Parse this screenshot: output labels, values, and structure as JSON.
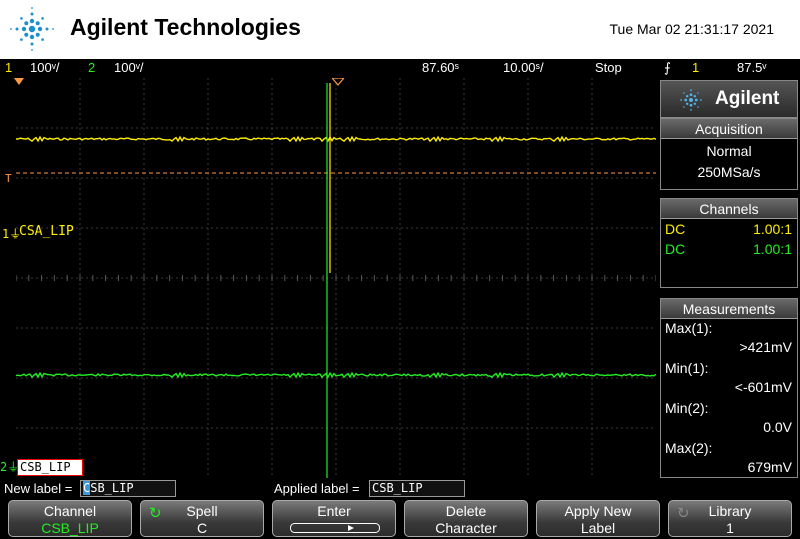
{
  "header": {
    "brand": "Agilent Technologies",
    "datetime": "Tue Mar 02 21:31:17 2021"
  },
  "statusbar": {
    "ch1_num": "1",
    "ch1_scale": "100ᵛ/",
    "ch2_num": "2",
    "ch2_scale": "100ᵛ/",
    "delay": "87.60ˢ",
    "timebase": "10.00ˢ/",
    "run_state": "Stop",
    "trig_icon": "⨍",
    "trig_source": "1",
    "trig_level": "87.5ᵛ"
  },
  "screen": {
    "ch1_tag": "1⏚",
    "ch1_label": "CSA_LIP",
    "trig_marker": "T",
    "ch2_tag": "2⏚",
    "ch2_label": "CSB_LIP"
  },
  "panel": {
    "agilent": "Agilent",
    "acquisition": {
      "title": "Acquisition",
      "mode": "Normal",
      "rate": "250MSa/s"
    },
    "channels": {
      "title": "Channels",
      "rows": [
        {
          "coupling": "DC",
          "probe": "1.00:1",
          "color": "#ffee00"
        },
        {
          "coupling": "DC",
          "probe": "1.00:1",
          "color": "#22ee22"
        }
      ]
    },
    "measurements": {
      "title": "Measurements",
      "items": [
        {
          "name": "Max(1):",
          "value": ">421mV"
        },
        {
          "name": "Min(1):",
          "value": "<-601mV"
        },
        {
          "name": "Min(2):",
          "value": "0.0V"
        },
        {
          "name": "Max(2):",
          "value": "679mV"
        }
      ]
    }
  },
  "labelbar": {
    "new_label_text": "New label =",
    "new_label_cursor": "C",
    "new_label_rest": "SB_LIP",
    "applied_label_text": "Applied label =",
    "applied_label_value": "CSB_LIP"
  },
  "softkeys": [
    {
      "top": "Channel",
      "bottom": "CSB_LIP"
    },
    {
      "top": "Spell",
      "bottom": "C"
    },
    {
      "top": "Enter",
      "bottom": ""
    },
    {
      "top": "Delete",
      "bottom": "Character"
    },
    {
      "top": "Apply New",
      "bottom": "Label"
    },
    {
      "top": "Library",
      "bottom": "1"
    }
  ],
  "colors": {
    "ch1": "#ffee00",
    "ch2": "#22ee22",
    "trigger": "#ff9944"
  }
}
